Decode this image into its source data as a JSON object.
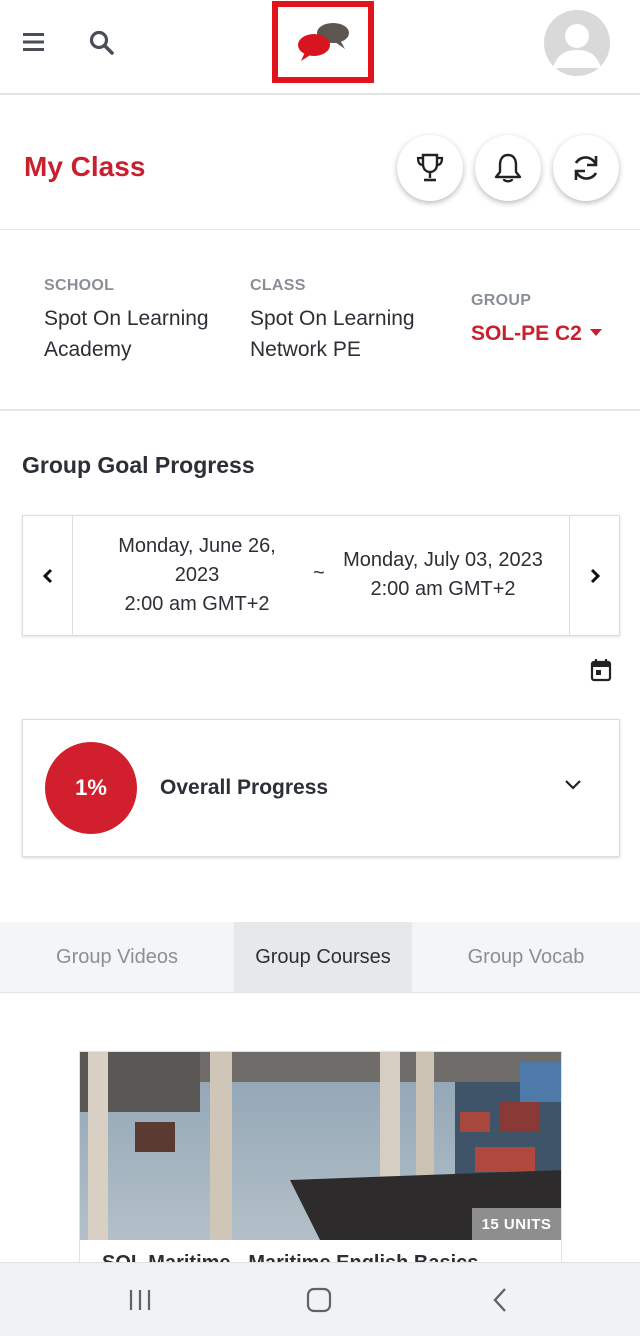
{
  "header": {
    "menu_icon": "hamburger-menu-icon",
    "search_icon": "search-icon",
    "logo_icon": "chat-bubbles-logo",
    "avatar_icon": "user-avatar-icon",
    "brand_red": "#e3131b"
  },
  "my_class": {
    "title": "My Class",
    "buttons": [
      "trophy-icon",
      "bell-icon",
      "refresh-icon"
    ],
    "accent_color": "#c8202e"
  },
  "info": {
    "school_label": "SCHOOL",
    "school_line1": "Spot On Learning",
    "school_line2": "Academy",
    "class_label": "CLASS",
    "class_line1": "Spot On Learning",
    "class_line2": "Network PE",
    "group_label": "GROUP",
    "group_value": "SOL-PE C2"
  },
  "goal": {
    "title": "Group Goal Progress",
    "start_line1": "Monday, June 26,",
    "start_line2": "2023",
    "start_line3": "2:00 am GMT+2",
    "separator": "~",
    "end_line1": "Monday, July 03, 2023",
    "end_line2": "2:00 am GMT+2",
    "calendar_icon": "calendar-icon"
  },
  "progress": {
    "percent_text": "1%",
    "percent_value": 1,
    "label": "Overall Progress"
  },
  "tabs": [
    {
      "label": "Group Videos",
      "active": false
    },
    {
      "label": "Group Courses",
      "active": true
    },
    {
      "label": "Group Vocab",
      "active": false
    }
  ],
  "course": {
    "units_badge": "15 UNITS",
    "title": "SOL Maritime - Maritime English Basics"
  },
  "android_nav": [
    "recent-apps-icon",
    "home-icon",
    "back-icon"
  ]
}
